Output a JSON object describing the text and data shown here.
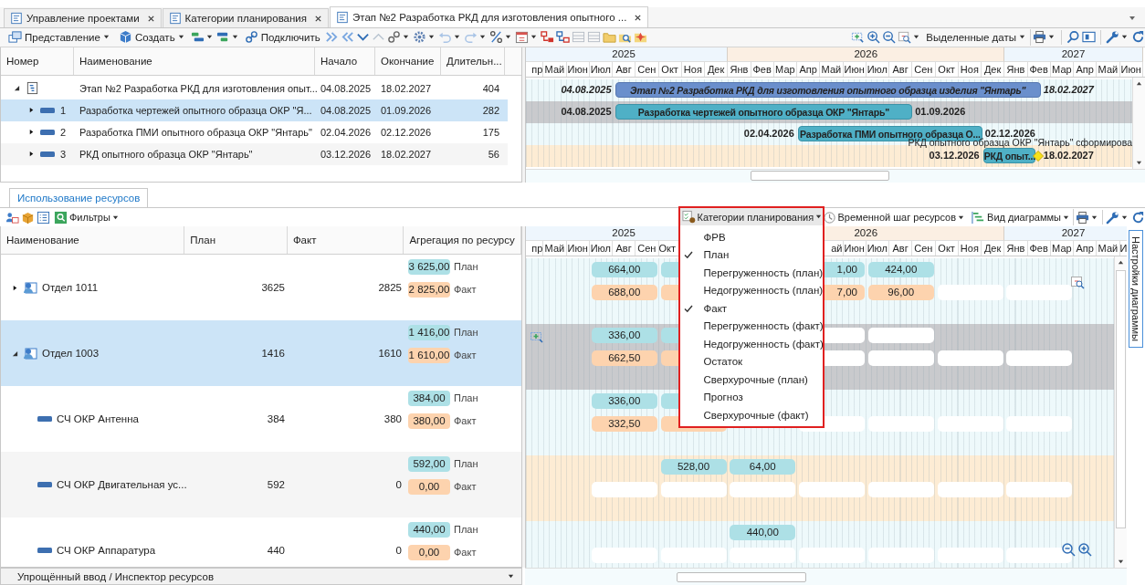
{
  "tabs": [
    {
      "label": "Управление проектами",
      "selected": false
    },
    {
      "label": "Категории планирования",
      "selected": false
    },
    {
      "label": "Этап №2 Разработка РКД для изготовления опытного ...",
      "selected": true
    }
  ],
  "toolbar": {
    "view": "Представление",
    "create": "Создать",
    "connect": "Подключить",
    "dates": "Выделенные даты"
  },
  "task_grid": {
    "columns": [
      "Номер",
      "Наименование",
      "Начало",
      "Окончание",
      "Длительн..."
    ],
    "rows": [
      {
        "name": "Этап №2 Разработка РКД для изготовления опыт...",
        "start": "04.08.2025",
        "end": "18.02.2027",
        "duration": "404",
        "kind": "summary",
        "expanded": true,
        "selected": false,
        "children": [
          {
            "number": "1",
            "name": "Разработка чертежей опытного образца ОКР \"Я...",
            "start": "04.08.2025",
            "end": "01.09.2026",
            "duration": "282",
            "kind": "task",
            "expanded": false,
            "selected": true
          },
          {
            "number": "2",
            "name": "Разработка ПМИ опытного образца ОКР \"Янтарь\"",
            "start": "02.04.2026",
            "end": "02.12.2026",
            "duration": "175",
            "kind": "task",
            "expanded": false,
            "selected": false
          },
          {
            "number": "3",
            "name": "РКД опытного образца ОКР \"Янтарь\"",
            "start": "03.12.2026",
            "end": "18.02.2027",
            "duration": "56",
            "kind": "task",
            "expanded": false,
            "selected": false
          }
        ]
      }
    ]
  },
  "task_gantt": {
    "years": [
      {
        "label": "2025",
        "months": [
          "пр",
          "Май",
          "Июн",
          "Июл",
          "Авг",
          "Сен",
          "Окт",
          "Ноя",
          "Дек"
        ]
      },
      {
        "label": "2026",
        "months": [
          "Янв",
          "Фев",
          "Мар",
          "Апр",
          "Май",
          "Июн",
          "Июл",
          "Авг",
          "Сен",
          "Окт",
          "Ноя",
          "Дек"
        ]
      },
      {
        "label": "2027",
        "months": [
          "Янв",
          "Фев",
          "Мар",
          "Апр",
          "Май",
          "Июн"
        ]
      }
    ],
    "bars": [
      {
        "start": "04.08.2025",
        "label": "Этап №2 Разработка РКД для изготовления опытного образца изделия \"Янтарь\"",
        "end": "18.02.2027",
        "kind": "summary"
      },
      {
        "start": "04.08.2025",
        "label": "Разработка чертежей опытного образца ОКР \"Янтарь\"",
        "end": "01.09.2026",
        "kind": "task"
      },
      {
        "start": "02.04.2026",
        "label": "Разработка ПМИ опытного образца О...",
        "end": "02.12.2026",
        "kind": "task"
      },
      {
        "start": "03.12.2026",
        "label": "РКД опыт...",
        "end": "18.02.2027",
        "kind": "task",
        "milestone": true,
        "note": "РКД опытного образца ОКР \"Янтарь\" сформирова"
      }
    ]
  },
  "resource_tab": {
    "label": "Использование ресурсов",
    "selected": true
  },
  "resource_toolbar": {
    "filters": "Фильтры",
    "category": "Категории планирования",
    "time_step": "Временной шаг ресурсов",
    "diagram_view": "Вид диаграммы"
  },
  "category_menu": [
    {
      "label": "ФРВ",
      "checked": false
    },
    {
      "label": "План",
      "checked": true
    },
    {
      "label": "Перегруженность (план)",
      "checked": false
    },
    {
      "label": "Недогруженность (план)",
      "checked": false
    },
    {
      "label": "Факт",
      "checked": true
    },
    {
      "label": "Перегруженность (факт)",
      "checked": false
    },
    {
      "label": "Недогруженность (факт)",
      "checked": false
    },
    {
      "label": "Остаток",
      "checked": false
    },
    {
      "label": "Сверхурочные (план)",
      "checked": false
    },
    {
      "label": "Прогноз",
      "checked": false
    },
    {
      "label": "Сверхурочные (факт)",
      "checked": false
    }
  ],
  "resource_grid": {
    "columns": [
      "Наименование",
      "План",
      "Факт",
      "Агрегация по ресурсу"
    ],
    "rows": [
      {
        "name": "Отдел 1011",
        "kind": "department",
        "expanded": false,
        "selected": false,
        "plan": "3625",
        "fact": "2825",
        "agg_plan": "3 625,00",
        "agg_plan_label": "План",
        "agg_fact": "2 825,00",
        "agg_fact_label": "Факт",
        "gantt_plan": [
          {
            "text": "664,00"
          },
          {
            "kind": "covered"
          },
          {
            "kind": "none"
          },
          {
            "text": "1,00",
            "kind": "cut"
          },
          {
            "text": "424,00"
          }
        ],
        "gantt_fact": [
          {
            "text": "688,00"
          },
          {
            "kind": "covered"
          },
          {
            "kind": "none"
          },
          {
            "text": "7,00",
            "kind": "cut"
          },
          {
            "text": "96,00"
          },
          {
            "kind": "blank"
          },
          {
            "kind": "blank"
          }
        ]
      },
      {
        "name": "Отдел 1003",
        "kind": "department",
        "expanded": true,
        "selected": true,
        "plan": "1416",
        "fact": "1610",
        "agg_plan": "1 416,00",
        "agg_plan_label": "План",
        "agg_fact": "1 610,00",
        "agg_fact_label": "Факт",
        "gantt_plan": [
          {
            "text": "336,00"
          },
          {
            "kind": "covered"
          },
          {
            "kind": "none"
          },
          {
            "kind": "blank"
          },
          {
            "kind": "blank"
          }
        ],
        "gantt_fact": [
          {
            "text": "662,50"
          },
          {
            "kind": "covered"
          },
          {
            "kind": "none"
          },
          {
            "kind": "blank"
          },
          {
            "kind": "blank"
          },
          {
            "kind": "blank"
          },
          {
            "kind": "blank"
          }
        ],
        "children": [
          {
            "name": "СЧ ОКР Антенна",
            "kind": "resource",
            "selected": false,
            "plan": "384",
            "fact": "380",
            "agg_plan": "384,00",
            "agg_plan_label": "План",
            "agg_fact": "380,00",
            "agg_fact_label": "Факт",
            "gantt_plan": [
              {
                "text": "336,00"
              },
              {
                "kind": "covered"
              }
            ],
            "gantt_fact": [
              {
                "text": "332,50"
              },
              {
                "kind": "covered"
              },
              {
                "kind": "none"
              },
              {
                "kind": "blank"
              },
              {
                "kind": "blank"
              },
              {
                "kind": "blank"
              },
              {
                "kind": "blank"
              }
            ]
          },
          {
            "name": "СЧ ОКР Двигательная ус...",
            "kind": "resource",
            "selected": false,
            "plan": "592",
            "fact": "0",
            "agg_plan": "592,00",
            "agg_plan_label": "План",
            "agg_fact": "0,00",
            "agg_fact_label": "Факт",
            "gantt_plan": [
              {
                "kind": "none"
              },
              {
                "text": "528,00"
              },
              {
                "text": "64,00"
              }
            ],
            "gantt_fact": [
              {
                "kind": "blank"
              },
              {
                "kind": "blank"
              },
              {
                "kind": "blank"
              },
              {
                "kind": "blank"
              },
              {
                "kind": "blank"
              },
              {
                "kind": "blank"
              },
              {
                "kind": "blank"
              }
            ]
          },
          {
            "name": "СЧ ОКР Аппаратура",
            "kind": "resource",
            "selected": false,
            "plan": "440",
            "fact": "0",
            "agg_plan": "440,00",
            "agg_plan_label": "План",
            "agg_fact": "0,00",
            "agg_fact_label": "Факт",
            "gantt_plan": [
              {
                "kind": "none"
              },
              {
                "kind": "none"
              },
              {
                "text": "440,00"
              }
            ],
            "gantt_fact": [
              {
                "kind": "blank"
              },
              {
                "kind": "blank"
              },
              {
                "kind": "blank"
              },
              {
                "kind": "blank"
              },
              {
                "kind": "blank"
              },
              {
                "kind": "blank"
              },
              {
                "kind": "blank"
              }
            ]
          }
        ]
      }
    ]
  },
  "resource_gantt": {
    "years": [
      {
        "label": "2025",
        "months": [
          {
            "label": "пр",
            "kind": "tail"
          },
          {
            "label": "Май"
          },
          {
            "label": "Июн"
          },
          {
            "label": "Июл"
          },
          {
            "label": "Авг"
          },
          {
            "label": "Сен"
          },
          {
            "label": "Окт",
            "kind": "head"
          },
          {
            "kind": "none"
          },
          {
            "kind": "none"
          }
        ]
      },
      {
        "label": "2026",
        "months": [
          {
            "kind": "none"
          },
          {
            "kind": "none"
          },
          {
            "kind": "none"
          },
          {
            "kind": "none"
          },
          {
            "label": "ай",
            "kind": "tail"
          },
          {
            "label": "Июн"
          },
          {
            "label": "Июл"
          },
          {
            "label": "Авг"
          },
          {
            "label": "Сен"
          },
          {
            "label": "Окт"
          },
          {
            "label": "Ноя"
          },
          {
            "label": "Дек"
          }
        ]
      },
      {
        "label": "2027",
        "months": [
          {
            "label": "Янв"
          },
          {
            "label": "Фев"
          },
          {
            "label": "Мар"
          },
          {
            "label": "Апр"
          },
          {
            "label": "Май"
          },
          {
            "label": "И",
            "kind": "head"
          }
        ]
      }
    ]
  },
  "side_tab": "Настройки диаграммы",
  "footer": "Упрощённый ввод / Инспектор ресурсов"
}
